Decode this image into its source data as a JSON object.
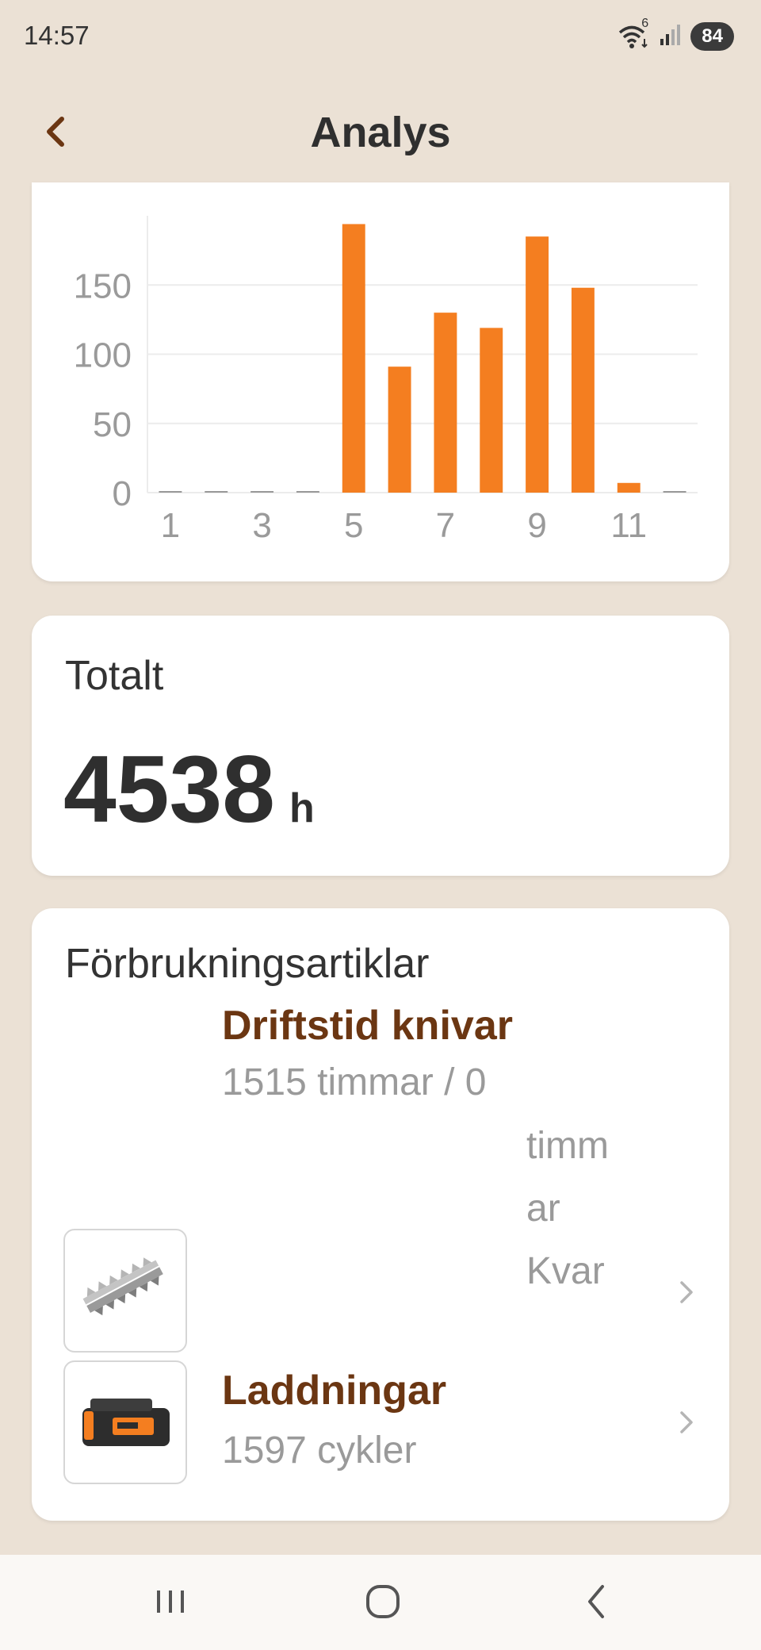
{
  "status": {
    "time": "14:57",
    "wifi_badge": "6",
    "battery": "84"
  },
  "header": {
    "title": "Analys",
    "back_icon": "chevron-left-icon"
  },
  "chart_data": {
    "type": "bar",
    "categories": [
      1,
      2,
      3,
      4,
      5,
      6,
      7,
      8,
      9,
      10,
      11,
      12
    ],
    "values": [
      0,
      0,
      0,
      0,
      194,
      91,
      130,
      119,
      185,
      148,
      7,
      0
    ],
    "xtick_labels": [
      "1",
      "3",
      "5",
      "7",
      "9",
      "11"
    ],
    "ytick_labels": [
      "0",
      "50",
      "100",
      "150"
    ],
    "ylim": [
      0,
      200
    ],
    "grid": "horizontal",
    "bar_color": "#f47e20"
  },
  "total": {
    "label": "Totalt",
    "value": "4538",
    "unit": "h"
  },
  "consumables": {
    "title": "Förbrukningsartiklar",
    "items": [
      {
        "name": "Driftstid knivar",
        "detail": "1515 timmar / 0",
        "detail_wrap": [
          "timm",
          "ar",
          "Kvar"
        ],
        "icon": "hedge-blades-icon"
      },
      {
        "name": "Laddningar",
        "detail": "1597 cykler",
        "icon": "battery-pack-icon"
      }
    ]
  },
  "colors": {
    "accent": "#f47e20",
    "brown": "#6b3612",
    "background": "#ebe1d5"
  },
  "navbar": {
    "icons": [
      "recent-apps-icon",
      "home-icon",
      "back-icon"
    ]
  }
}
